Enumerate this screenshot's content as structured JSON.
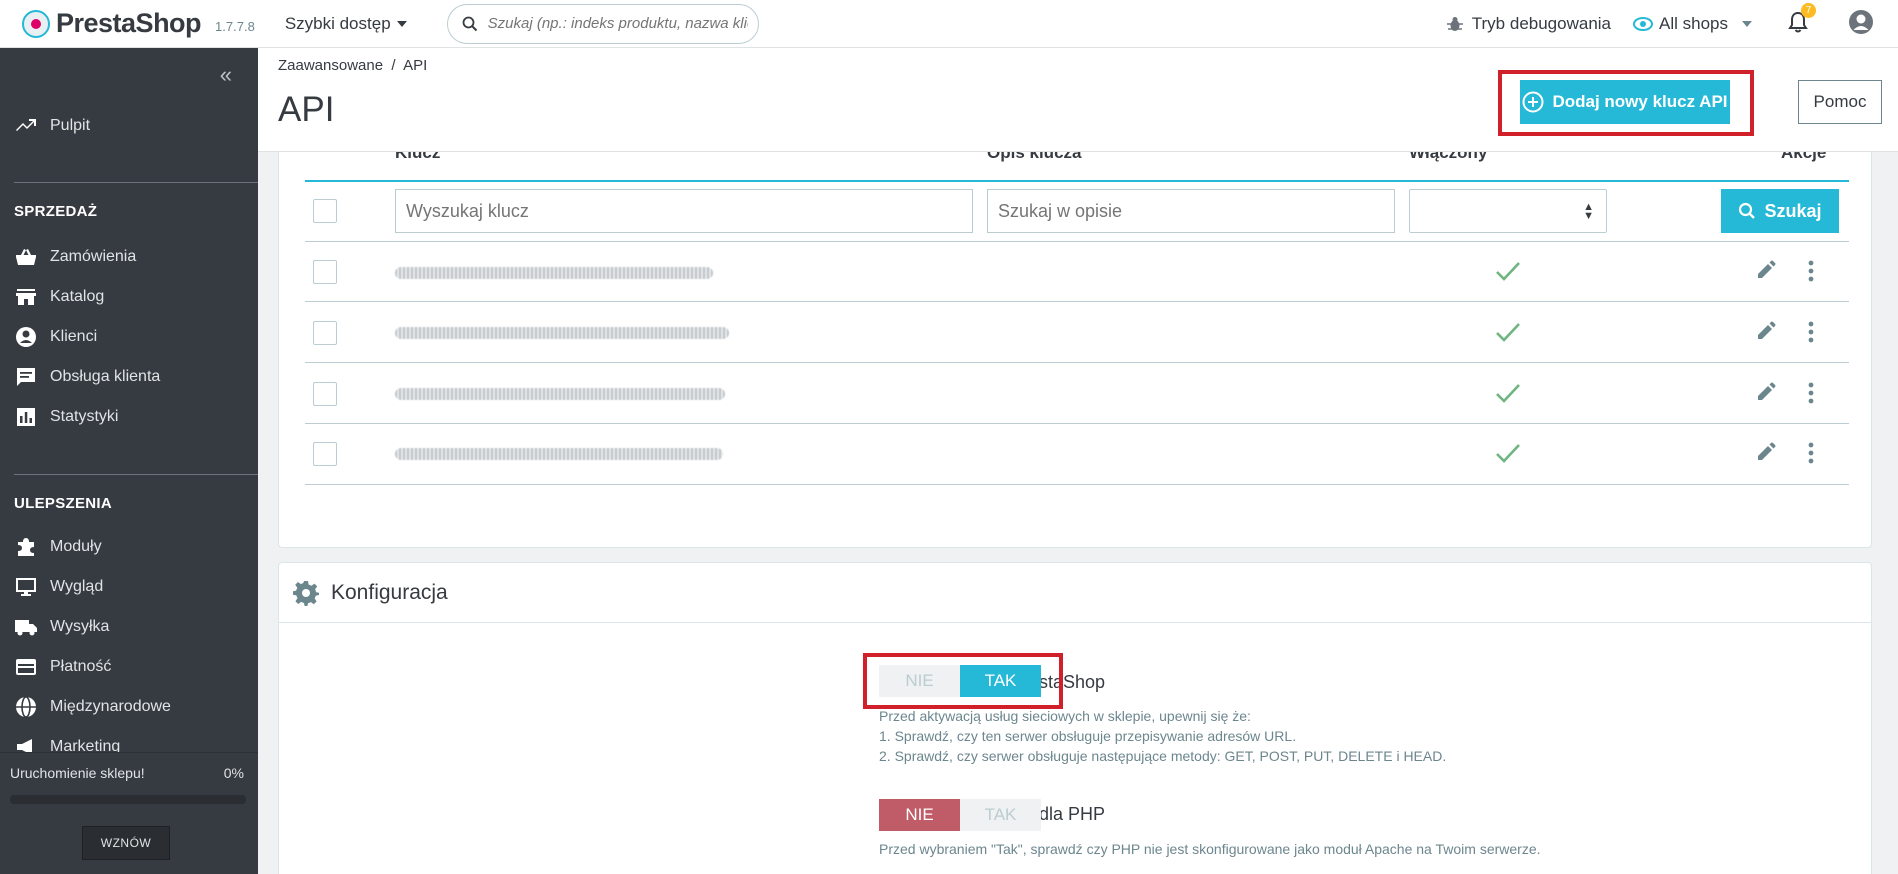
{
  "topbar": {
    "logo_text": "PrestaShop",
    "version": "1.7.7.8",
    "quick_access": "Szybki dostęp",
    "search_placeholder": "Szukaj (np.: indeks produktu, nazwa klie",
    "debug_mode": "Tryb debugowania",
    "shops": "All shops",
    "notifications_count": "7"
  },
  "sidebar": {
    "dashboard": "Pulpit",
    "sections": {
      "sales": "SPRZEDAŻ",
      "improvements": "ULEPSZENIA"
    },
    "sales_items": [
      "Zamówienia",
      "Katalog",
      "Klienci",
      "Obsługa klienta",
      "Statystyki"
    ],
    "improvement_items": [
      "Moduły",
      "Wygląd",
      "Wysyłka",
      "Płatność",
      "Międzynarodowe",
      "Marketing"
    ],
    "launch": {
      "title": "Uruchomienie sklepu!",
      "percent_label": "0%",
      "progress": 0,
      "resume_label": "WZNÓW"
    }
  },
  "header": {
    "breadcrumb": "Zaawansowane  /  API",
    "title": "API",
    "add_button": "Dodaj nowy klucz API",
    "help_button": "Pomoc"
  },
  "table": {
    "columns": [
      "Klucz",
      "Opis klucza",
      "Włączony",
      "Akcje"
    ],
    "filter_key_placeholder": "Wyszukaj klucz",
    "filter_desc_placeholder": "Szukaj w opisie",
    "search_button": "Szukaj",
    "rows": [
      {
        "enabled": true
      },
      {
        "enabled": true
      },
      {
        "enabled": true
      },
      {
        "enabled": true
      }
    ]
  },
  "config": {
    "title": "Konfiguracja",
    "api_label": "Włącz API PrestaShop",
    "api_no": "NIE",
    "api_yes": "TAK",
    "api_value": "TAK",
    "api_help": [
      "Przed aktywacją usług sieciowych w sklepie, upewnij się że:",
      "1. Sprawdź, czy ten serwer obsługuje przepisywanie adresów URL.",
      "2. Sprawdź, czy serwer obsługuje następujące metody: GET, POST, PUT, DELETE i HEAD."
    ],
    "cgi_label": "Włącz tryb CGI dla PHP",
    "cgi_no": "NIE",
    "cgi_yes": "TAK",
    "cgi_value": "NIE",
    "cgi_help": "Przed wybraniem \"Tak\", sprawdź czy PHP nie jest skonfigurowane jako moduł Apache na Twoim serwerze."
  },
  "colors": {
    "primary": "#25b9d7",
    "sidebar": "#363a41",
    "danger": "#c05c67",
    "success": "#70b580",
    "highlight": "#d0202a"
  }
}
